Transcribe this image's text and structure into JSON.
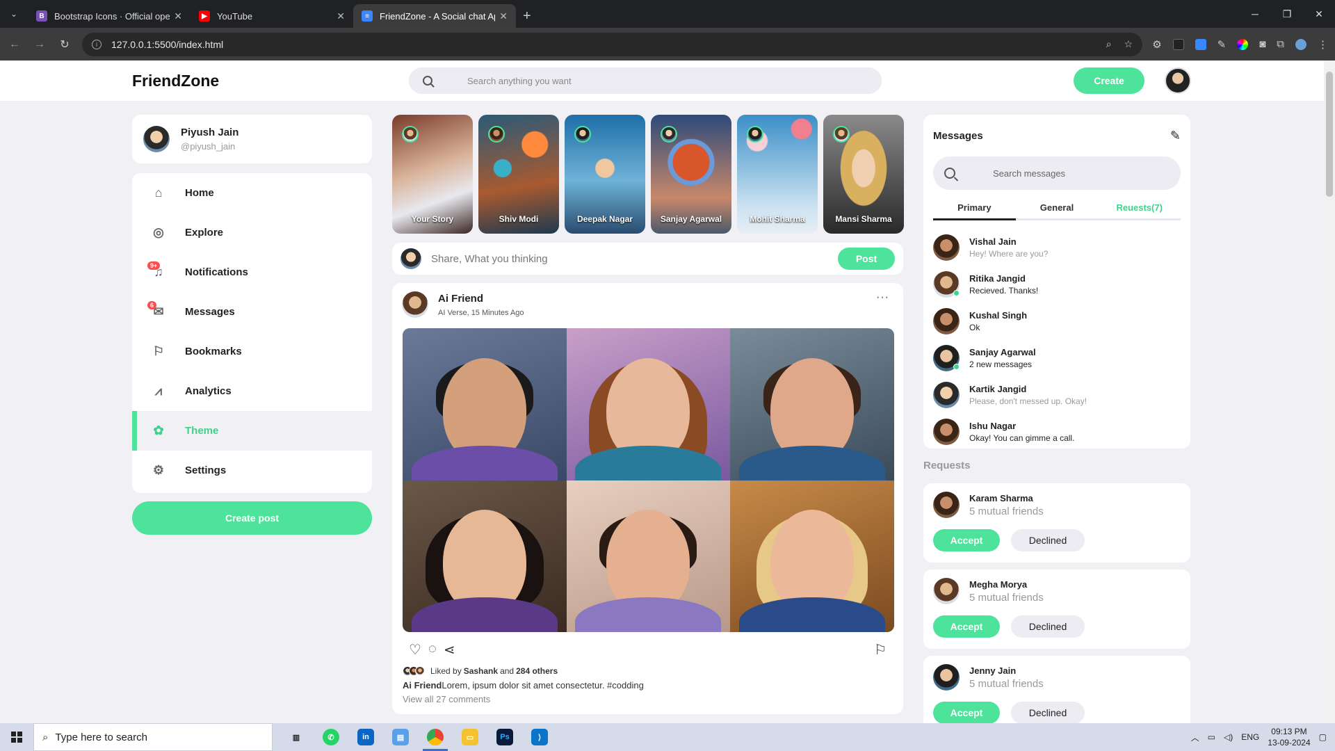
{
  "browser": {
    "tabs": [
      {
        "title": "Bootstrap Icons · Official open s",
        "favicon": "B",
        "color": "#7952b3"
      },
      {
        "title": "YouTube",
        "favicon": "▶",
        "color": "#ff0000"
      },
      {
        "title": "FriendZone - A Social chat App",
        "favicon": "≡",
        "color": "#3a86ff"
      }
    ],
    "url": "127.0.0.1:5500/index.html"
  },
  "nav": {
    "logo": "FriendZone",
    "search_placeholder": "Search anything you want",
    "create_label": "Create"
  },
  "profile": {
    "name": "Piyush Jain",
    "handle": "@piyush_jain"
  },
  "menu": {
    "items": [
      {
        "label": "Home",
        "icon": "house-icon"
      },
      {
        "label": "Explore",
        "icon": "compass-icon"
      },
      {
        "label": "Notifications",
        "icon": "bell-icon",
        "badge": "9+"
      },
      {
        "label": "Messages",
        "icon": "envelope-icon",
        "badge": "6"
      },
      {
        "label": "Bookmarks",
        "icon": "bookmark-icon"
      },
      {
        "label": "Analytics",
        "icon": "graph-icon"
      },
      {
        "label": "Theme",
        "icon": "palette-icon",
        "active": true
      },
      {
        "label": "Settings",
        "icon": "gear-icon"
      }
    ],
    "create_post": "Create post"
  },
  "stories": [
    {
      "name": "Your Story"
    },
    {
      "name": "Shiv Modi"
    },
    {
      "name": "Deepak Nagar"
    },
    {
      "name": "Sanjay Agarwal"
    },
    {
      "name": "Mohit Sharma"
    },
    {
      "name": "Mansi Sharma"
    }
  ],
  "share": {
    "placeholder": "Share, What you thinking",
    "button": "Post"
  },
  "post": {
    "author": "Ai Friend",
    "meta": "AI Verse, 15 Minutes Ago",
    "liked_prefix": "Liked by ",
    "liked_user": "Sashank",
    "liked_mid": " and ",
    "liked_others": "284 others",
    "caption_author": "Ai Friend",
    "caption_text": "Lorem, ipsum dolor sit amet consectetur. #codding",
    "view_comments": "View all 27 comments"
  },
  "messages": {
    "title": "Messages",
    "search_placeholder": "Search messages",
    "tabs": [
      "Primary",
      "General",
      "Reuests(7)"
    ],
    "list": [
      {
        "name": "Vishal Jain",
        "text": "Hey! Where are you?",
        "light": true,
        "online": false
      },
      {
        "name": "Ritika Jangid",
        "text": "Recieved. Thanks!",
        "light": false,
        "online": true
      },
      {
        "name": "Kushal Singh",
        "text": "Ok",
        "light": false,
        "online": false
      },
      {
        "name": "Sanjay Agarwal",
        "text": "2 new messages",
        "light": false,
        "online": true
      },
      {
        "name": "Kartik Jangid",
        "text": "Please, don't messed up. Okay!",
        "light": true,
        "online": false
      },
      {
        "name": "Ishu Nagar",
        "text": "Okay! You can gimme a call.",
        "light": false,
        "online": false
      }
    ]
  },
  "requests": {
    "title": "Requests",
    "items": [
      {
        "name": "Karam Sharma",
        "sub": "5 mutual friends"
      },
      {
        "name": "Megha Morya",
        "sub": "5 mutual friends"
      },
      {
        "name": "Jenny Jain",
        "sub": "5 mutual friends"
      }
    ],
    "accept": "Accept",
    "decline": "Declined"
  },
  "taskbar": {
    "search_placeholder": "Type here to search",
    "lang": "ENG",
    "time": "09:13 PM",
    "date": "13-09-2024"
  }
}
